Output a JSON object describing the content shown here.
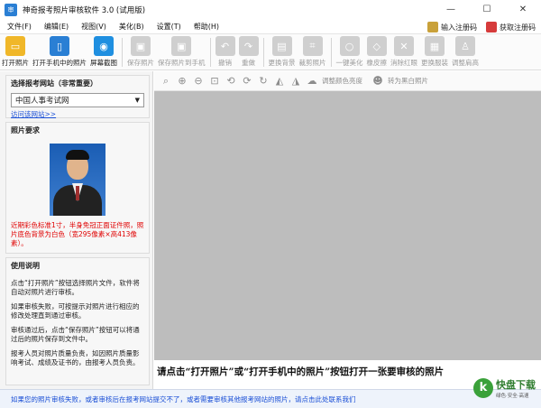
{
  "window": {
    "title": "神奇报考照片审核软件 3.0 (试用版)",
    "icon_text": "审"
  },
  "menu": [
    "文件(F)",
    "编辑(E)",
    "视图(V)",
    "美化(B)",
    "设置(T)",
    "帮助(H)"
  ],
  "menu_right": {
    "register_code": "输入注册码",
    "get_code": "获取注册码"
  },
  "toolbar": {
    "open_photo": "打开照片",
    "open_phone": "打开手机中的照片",
    "screenshot": "屏幕截图",
    "save_photo": "保存照片",
    "save_to_phone": "保存照片到手机",
    "undo": "撤销",
    "redo": "重做",
    "change_bg": "更换背景",
    "crop": "裁剪照片",
    "beautify": "一键美化",
    "eraser": "橡皮擦",
    "red_eye": "消除红眼",
    "change_suit": "更换服装",
    "adjust_height": "调整肩高"
  },
  "left": {
    "site_title": "选择报考网站（非常重要）",
    "site_value": "中国人事考试网",
    "site_link": "访问该网站>>",
    "req_title": "照片要求",
    "req_text": "近期彩色标准1寸，半身免冠正面证件照，照片底色背景为白色（宽295像素×高413像素）。",
    "usage_title": "使用说明",
    "usage_p1": "点击“打开照片”按钮选择照片文件，软件将自动对照片进行审核。",
    "usage_p2": "如果审核失败，可按提示对照片进行相应的修改处理直到通过审核。",
    "usage_p3": "审核通过后，点击“保存照片”按钮可以将通过后的照片保存到文件中。",
    "usage_p4": "报考人员对照片质量负责，如因照片质量影响考试、成绩及证书的，由报考人员负责。"
  },
  "image_toolbar": {
    "adjust_color": "调整颜色亮度",
    "to_bw": "转为黑白照片"
  },
  "canvas": {
    "hint": "请点击“打开照片”或“打开手机中的照片”按钮打开一张要审核的照片"
  },
  "status": {
    "message": "如果您的照片审核失败，或者审核后在报考网站提交不了，或者需要审核其他报考网站的照片，请点击此处联系我们"
  },
  "watermark": {
    "logo": "k",
    "name": "快盘下载",
    "sub": "绿色·安全·高速"
  },
  "colors": {
    "accent": "#2a7fd4",
    "canvas_bg": "#bdbdbd",
    "warning": "#e00000",
    "link": "#1a4fd6"
  }
}
